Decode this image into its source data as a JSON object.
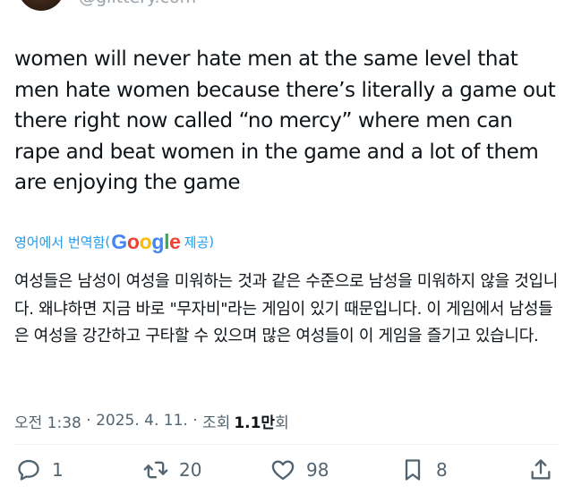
{
  "author": {
    "handle": "@glittery.com"
  },
  "tweet": {
    "text": "women will never hate men at the same level that men hate women because there’s literally a game out there right now called “no mercy” where men can rape and beat women in the game and a lot of them are enjoying the game"
  },
  "translation": {
    "label": "영어에서 번역함",
    "open_paren": "(",
    "google_letters": [
      "G",
      "o",
      "o",
      "g",
      "l",
      "e"
    ],
    "provide_label": "제공",
    "close_paren": ")",
    "text": "여성들은 남성이 여성을 미워하는 것과 같은 수준으로 남성을 미워하지 않을 것입니다. 왜냐하면 지금 바로 \"무자비\"라는 게임이 있기 때문입니다. 이 게임에서 남성들은 여성을 강간하고 구타할 수 있으며 많은 여성들이 이 게임을 즐기고 있습니다."
  },
  "meta": {
    "time": "오전 1:38",
    "sep1": " · ",
    "date": "2025. 4. 11.",
    "sep2": " · ",
    "views_label": "조회",
    "views_count": "1.1만",
    "views_unit": "회"
  },
  "actions": {
    "reply_count": "1",
    "retweet_count": "20",
    "like_count": "98",
    "bookmark_count": "8"
  },
  "icons": {
    "reply": "reply-icon",
    "retweet": "retweet-icon",
    "like": "heart-icon",
    "bookmark": "bookmark-icon",
    "share": "share-icon"
  },
  "colors": {
    "text": "#0f1419",
    "secondary": "#536471",
    "link": "#1d9bf0",
    "icon": "#536471"
  }
}
